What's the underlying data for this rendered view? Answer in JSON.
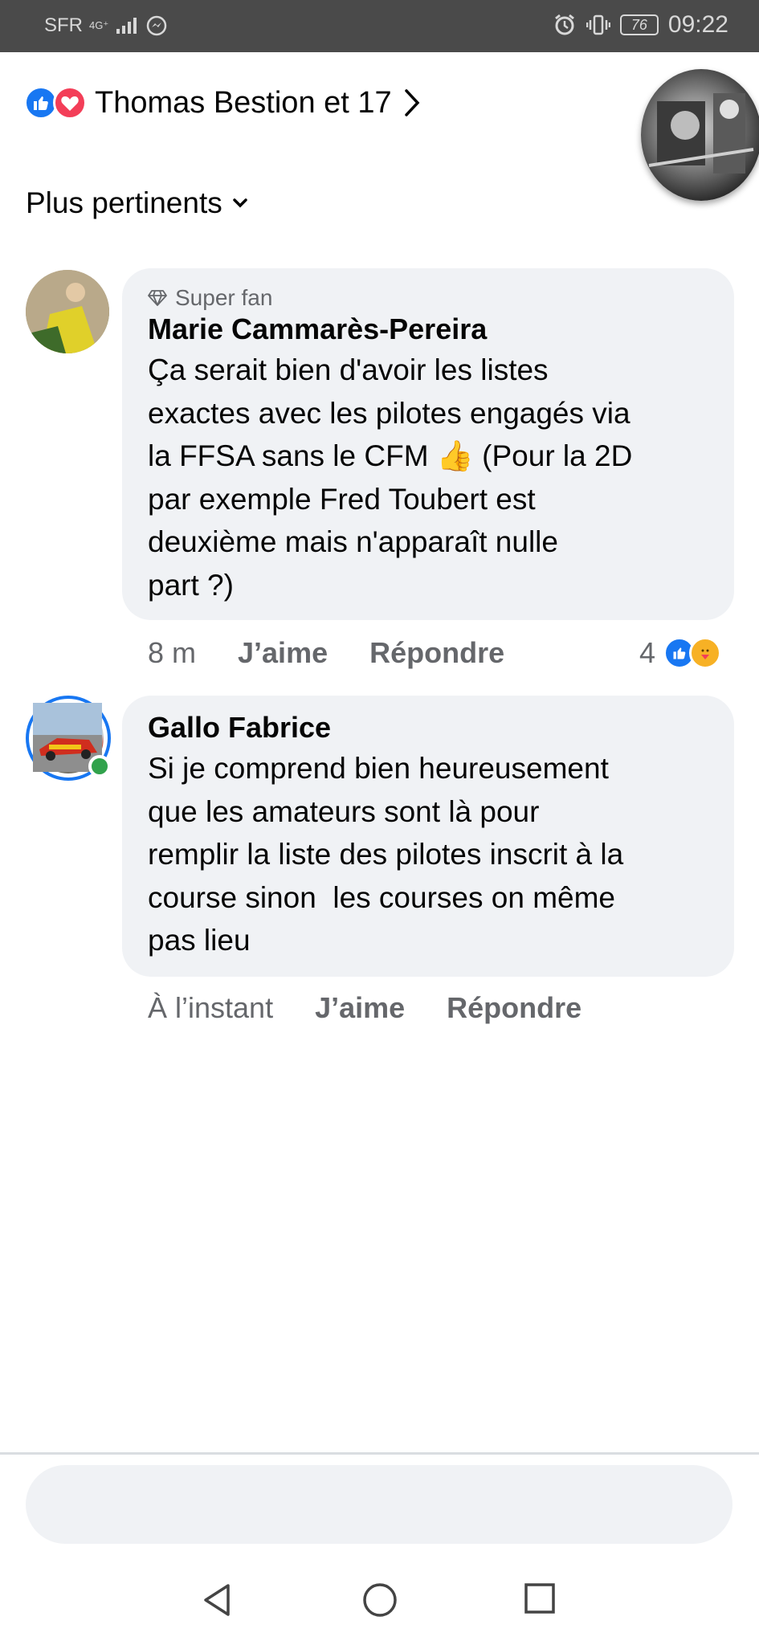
{
  "status_bar": {
    "carrier": "SFR",
    "network": "4G⁺",
    "battery": "76",
    "time": "09:22"
  },
  "header": {
    "reactors_label": "Thomas Bestion et 17"
  },
  "sort": {
    "label": "Plus pertinents"
  },
  "comments": [
    {
      "badge": "Super fan",
      "author": "Marie Cammarès-Pereira",
      "lines": [
        "Ça serait bien d'avoir les listes",
        "exactes avec les pilotes engagés via",
        "la FFSA sans le CFM",
        " (Pour la 2D",
        "par exemple Fred Toubert est",
        "deuxième mais n'apparaît nulle",
        "part ?)"
      ],
      "emoji": "👍",
      "time": "8 m",
      "like_label": "J’aime",
      "reply_label": "Répondre",
      "reaction_count": "4"
    },
    {
      "author": "Gallo Fabrice",
      "lines": [
        "Si je comprend bien heureusement",
        "que les amateurs sont là pour",
        "remplir la liste des pilotes inscrit à la",
        "course sinon  les courses on même",
        "pas lieu"
      ],
      "time": "À l’instant",
      "like_label": "J’aime",
      "reply_label": "Répondre"
    }
  ],
  "colors": {
    "facebook_blue": "#1877f2",
    "love_red": "#f33e58",
    "online_green": "#31a24c",
    "bubble_gray": "#f0f2f5",
    "secondary_text": "#65676b"
  },
  "icons": {
    "status": [
      "signal-icon",
      "messenger-icon",
      "alarm-icon",
      "vibrate-icon",
      "battery-icon"
    ],
    "header": [
      "like-reaction-icon",
      "love-reaction-icon",
      "chevron-right-icon"
    ],
    "nav": [
      "back-icon",
      "home-icon",
      "recents-icon"
    ]
  }
}
